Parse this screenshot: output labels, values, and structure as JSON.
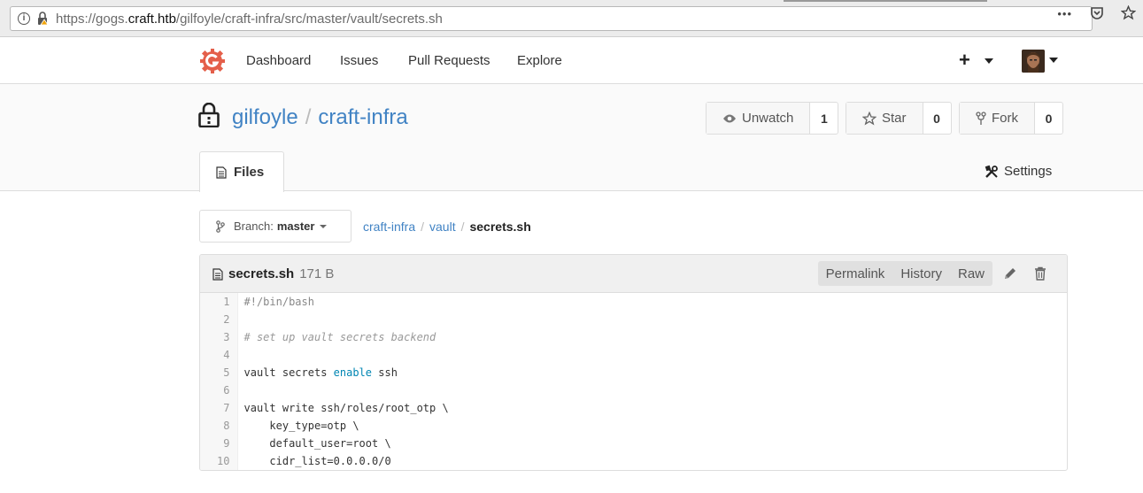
{
  "browser": {
    "url_prefix": "https://gogs.",
    "url_host": "craft.htb",
    "url_path": "/gilfoyle/craft-infra/src/master/vault/secrets.sh",
    "more_label": "•••"
  },
  "nav": {
    "items": [
      "Dashboard",
      "Issues",
      "Pull Requests",
      "Explore"
    ],
    "plus_label": "+"
  },
  "repo": {
    "owner": "gilfoyle",
    "separator": "/",
    "name": "craft-infra",
    "watch": {
      "label": "Unwatch",
      "count": "1"
    },
    "star": {
      "label": "Star",
      "count": "0"
    },
    "fork": {
      "label": "Fork",
      "count": "0"
    },
    "tabs": {
      "files": "Files",
      "settings": "Settings"
    }
  },
  "branch": {
    "label": "Branch:",
    "value": "master"
  },
  "breadcrumb": {
    "root": "craft-infra",
    "dir": "vault",
    "file": "secrets.sh",
    "divider": "/"
  },
  "file": {
    "name": "secrets.sh",
    "size": "171 B",
    "actions": [
      "Permalink",
      "History",
      "Raw"
    ]
  },
  "code": {
    "line_numbers": [
      "1",
      "2",
      "3",
      "4",
      "5",
      "6",
      "7",
      "8",
      "9",
      "10"
    ],
    "l1": "#!/bin/bash",
    "l3": "# set up vault secrets backend",
    "l5a": "vault secrets ",
    "l5b": "enable",
    "l5c": " ssh",
    "l7": "vault write ssh/roles/root_otp \\",
    "l8": "    key_type=otp \\",
    "l9": "    default_user=root \\",
    "l10": "    cidr_list=0.0.0.0/0"
  },
  "colors": {
    "link": "#4183c4",
    "keyword": "#0086b3",
    "logo": "#e45f4a"
  }
}
